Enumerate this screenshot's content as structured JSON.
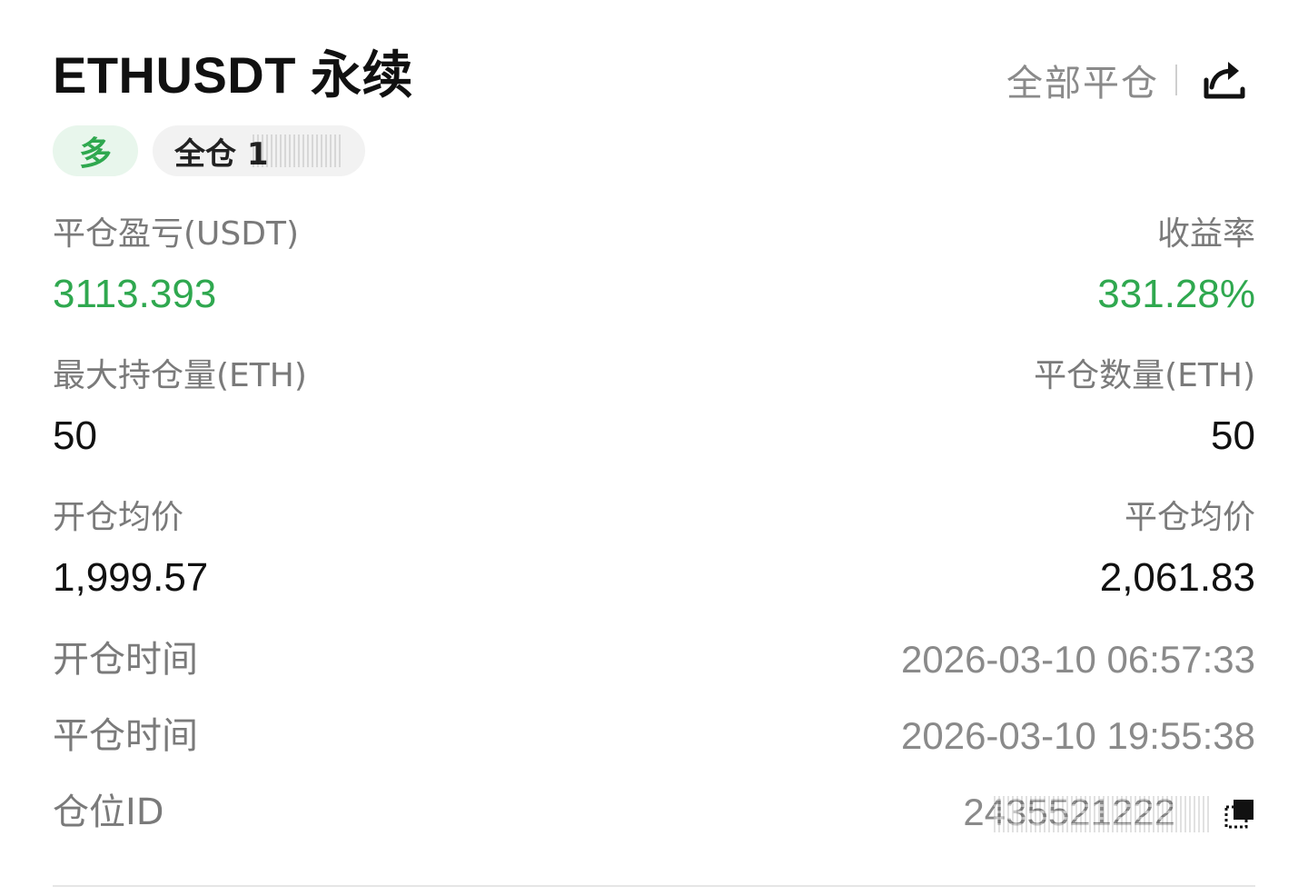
{
  "header": {
    "title": "ETHUSDT 永续",
    "close_all_label": "全部平仓",
    "share_icon": "share-icon"
  },
  "tags": {
    "direction": "多",
    "margin_mode": "全仓 1"
  },
  "stats": {
    "close_pnl_label": "平仓盈亏(USDT)",
    "close_pnl_value": "3113.393",
    "roi_label": "收益率",
    "roi_value": "331.28%",
    "max_position_label": "最大持仓量(ETH)",
    "max_position_value": "50",
    "close_qty_label": "平仓数量(ETH)",
    "close_qty_value": "50",
    "avg_open_label": "开仓均价",
    "avg_open_value": "1,999.57",
    "avg_close_label": "平仓均价",
    "avg_close_value": "2,061.83"
  },
  "info": {
    "open_time_label": "开仓时间",
    "open_time_value": "2026-03-10 06:57:33",
    "close_time_label": "平仓时间",
    "close_time_value": "2026-03-10 19:55:38",
    "position_id_label": "仓位ID",
    "position_id_value": "2435521222"
  },
  "colors": {
    "accent_green": "#2fa84f",
    "label_gray": "#7a7a7a"
  }
}
